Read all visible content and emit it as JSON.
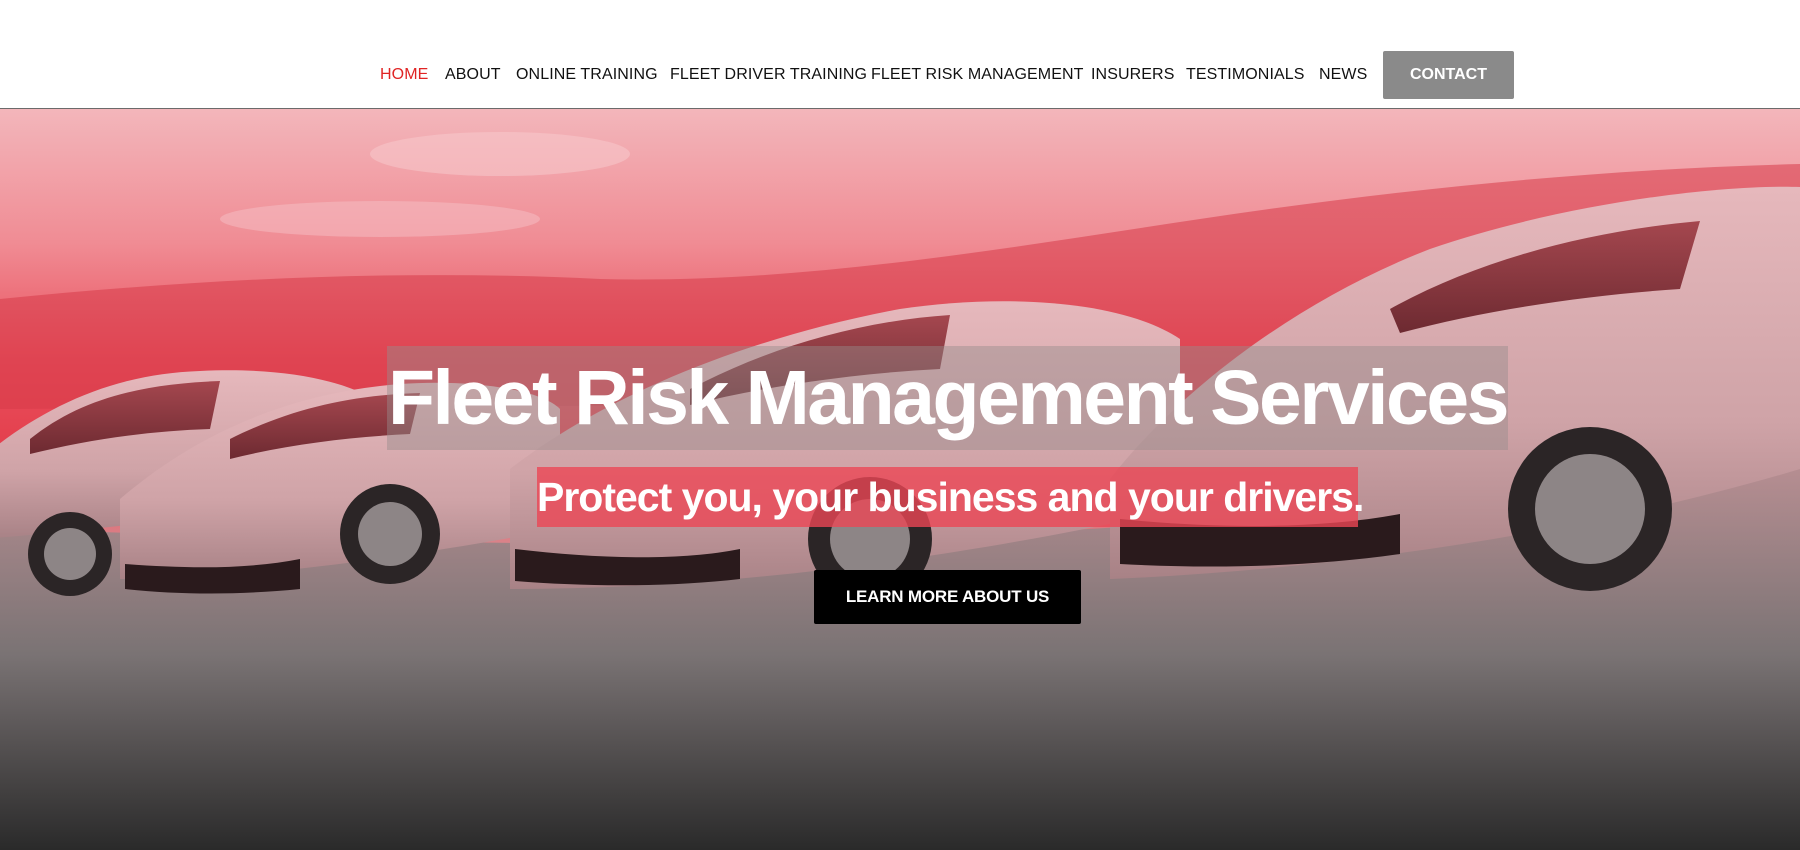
{
  "nav": {
    "items": [
      {
        "label": "HOME",
        "active": true
      },
      {
        "label": "ABOUT",
        "active": false
      },
      {
        "label": "ONLINE TRAINING",
        "active": false
      },
      {
        "label": "FLEET DRIVER TRAINING",
        "active": false
      },
      {
        "label": "FLEET RISK MANAGEMENT",
        "active": false
      },
      {
        "label": "INSURERS",
        "active": false
      },
      {
        "label": "TESTIMONIALS",
        "active": false
      },
      {
        "label": "NEWS",
        "active": false
      }
    ],
    "contact_label": "CONTACT"
  },
  "hero": {
    "title": "Fleet Risk Management Services",
    "subtitle": "Protect you, your business and your drivers.",
    "cta_label": "LEARN MORE ABOUT US",
    "image": "fleet-of-cars-photo"
  },
  "colors": {
    "active_nav": "#e02424",
    "contact_button": "#8a8a8a",
    "cta_button": "#000000",
    "hero_tint": "#e4404e"
  }
}
